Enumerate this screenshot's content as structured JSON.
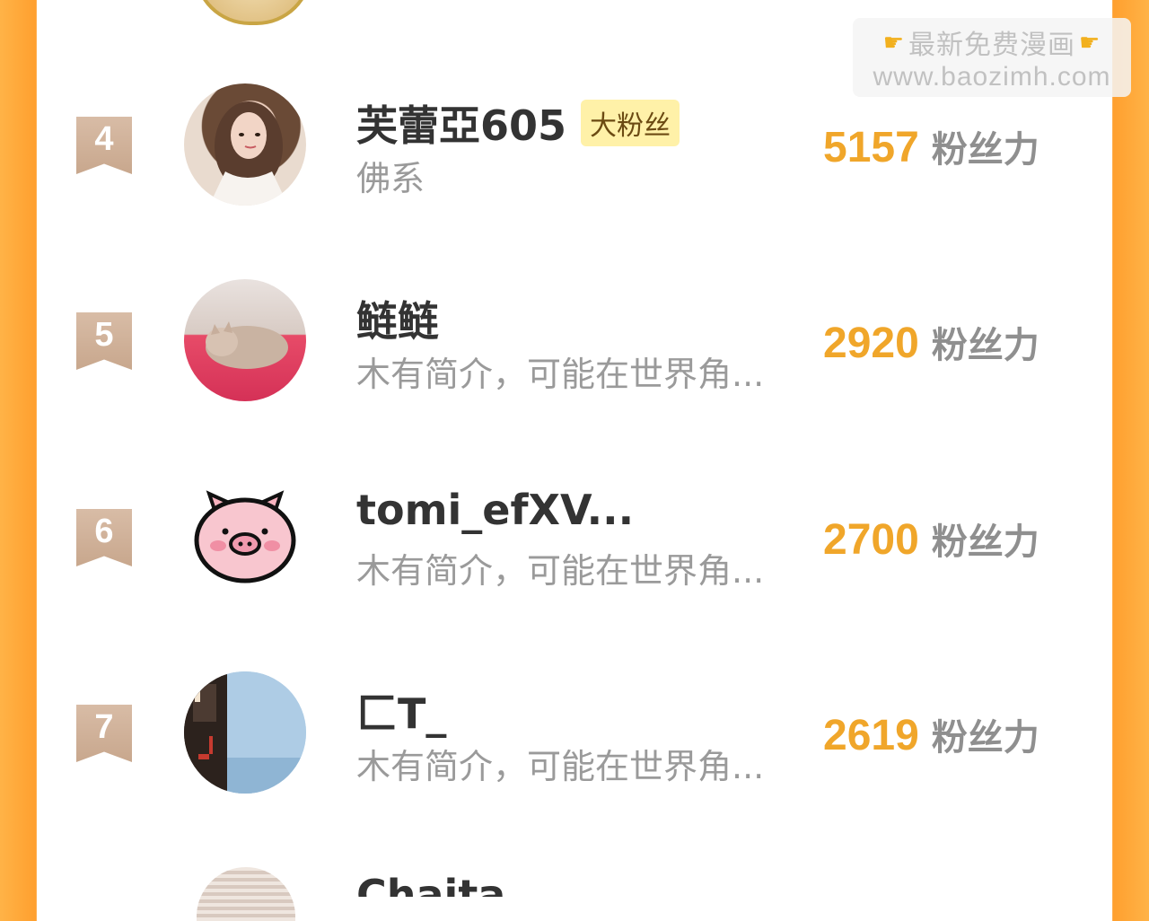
{
  "watermark": {
    "line1": "最新免费漫画",
    "url": "www.baozimh.com"
  },
  "rows": [
    {
      "rank": "4",
      "name": "芙蕾亞605",
      "tag": "大粉丝",
      "bio": "佛系",
      "score": "5157",
      "unit": "粉丝力"
    },
    {
      "rank": "5",
      "name": "鲢鲢",
      "bio": "木有简介，可能在世界角...",
      "score": "2920",
      "unit": "粉丝力"
    },
    {
      "rank": "6",
      "name": "tomi_efXV...",
      "bio": "木有简介，可能在世界角...",
      "score": "2700",
      "unit": "粉丝力"
    },
    {
      "rank": "7",
      "name": "匚T_",
      "bio": "木有简介，可能在世界角...",
      "score": "2619",
      "unit": "粉丝力"
    }
  ],
  "next_partial_name": "Chaita",
  "colors": {
    "accent_orange": "#f0a62a",
    "badge_tan": "#c8a78d",
    "side_orange": "#ff9f2e"
  }
}
